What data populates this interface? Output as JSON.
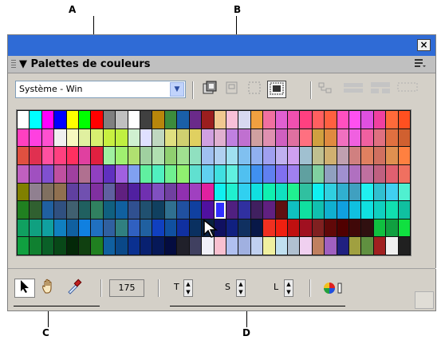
{
  "callouts": {
    "a": "A",
    "b": "B",
    "c": "C",
    "d": "D"
  },
  "panel": {
    "close_label": "×",
    "title": "▼ Palettes de couleurs",
    "options_icon": "menu-lines-icon",
    "palette_select": {
      "value": "Système - Win"
    }
  },
  "toolbar": {
    "count": "175",
    "spin_labels": {
      "t": "T",
      "s": "S",
      "l": "L"
    }
  },
  "palette": {
    "selected_row": 5,
    "selected_col": 16,
    "rows": [
      [
        "#ffffff",
        "#00ffff",
        "#ff00ff",
        "#0000ff",
        "#ffff00",
        "#00ff00",
        "#ff0000",
        "#808080",
        "#c0c0c0",
        "#ffffff",
        "#404040",
        "#b8860b",
        "#3c8c3c",
        "#1a5fa8",
        "#6a2a8a",
        "#9b1e1e",
        "#f0c890",
        "#f8c0d8",
        "#d8d8f0",
        "#f0a040",
        "#f070a0",
        "#e060d0",
        "#f050b0",
        "#ff4080",
        "#ff6060",
        "#ff6040",
        "#ff50c0",
        "#ff50f0",
        "#e050e0",
        "#f040a0",
        "#ff6a3a",
        "#ff5020"
      ],
      [
        "#ff40c0",
        "#ff40e0",
        "#ff50d0",
        "#f0f0f0",
        "#f8f8c0",
        "#e0f0a0",
        "#d8f070",
        "#c8f040",
        "#c0f040",
        "#d0f0d0",
        "#e0e0ff",
        "#c0d8c0",
        "#e0e080",
        "#d0d070",
        "#e0d060",
        "#d0a0e0",
        "#e0b0d0",
        "#c080e0",
        "#c070d0",
        "#d0a0a0",
        "#e090b0",
        "#d060c0",
        "#e070a0",
        "#ff7080",
        "#d0a040",
        "#e08a40",
        "#f070c0",
        "#f060e0",
        "#f060a0",
        "#e07080",
        "#e07040",
        "#d06030"
      ],
      [
        "#e05040",
        "#e03050",
        "#ff50a0",
        "#ff4080",
        "#ff3060",
        "#e040a0",
        "#e02040",
        "#a0f0a0",
        "#a0f070",
        "#b0e070",
        "#a0d0a0",
        "#b0e0b0",
        "#90d070",
        "#a0e090",
        "#90e0c0",
        "#a0c0f0",
        "#b0d0f0",
        "#a0e0f0",
        "#80c0f0",
        "#90b0f0",
        "#a0a0f0",
        "#c0b0f0",
        "#d0a0f0",
        "#a0c0d0",
        "#c0c090",
        "#d0b070",
        "#c0a0b0",
        "#d08080",
        "#e08060",
        "#d07060",
        "#e09050",
        "#ff8040"
      ],
      [
        "#c060c0",
        "#a050c0",
        "#8050d0",
        "#c050a0",
        "#a040a0",
        "#b07090",
        "#9040c0",
        "#6030c0",
        "#a060e0",
        "#80a0f0",
        "#60f0a0",
        "#50f0c0",
        "#70f090",
        "#90f070",
        "#60e0d0",
        "#60d0f0",
        "#40e0e0",
        "#60f0e0",
        "#50c0f0",
        "#4090f0",
        "#6080f0",
        "#8070f0",
        "#a080f0",
        "#60a0a0",
        "#80d0a0",
        "#90a0c0",
        "#a090d0",
        "#b070c0",
        "#c070a0",
        "#c06080",
        "#e06070",
        "#f07060"
      ],
      [
        "#808000",
        "#908090",
        "#807060",
        "#907050",
        "#6040a0",
        "#7050b0",
        "#8030a0",
        "#6060a0",
        "#602080",
        "#5020a0",
        "#7030b0",
        "#8050c0",
        "#7040a0",
        "#9030b0",
        "#a040c0",
        "#e020a0",
        "#10f0f0",
        "#20f0d0",
        "#30d0f0",
        "#10e0e0",
        "#10f0b0",
        "#10e0c0",
        "#20f090",
        "#30c0a0",
        "#10f0f0",
        "#30d0e0",
        "#30b0d0",
        "#40a0c0",
        "#20f0f0",
        "#30c0d0",
        "#40d0f0",
        "#50f0d0"
      ],
      [
        "#208020",
        "#306030",
        "#2060a0",
        "#305080",
        "#406070",
        "#206060",
        "#308060",
        "#106080",
        "#1060a0",
        "#305090",
        "#205070",
        "#104060",
        "#307090",
        "#2050a0",
        "#1040a0",
        "#5010a0",
        "#3030ff",
        "#502080",
        "#3030a0",
        "#402060",
        "#602080",
        "#601010",
        "#10c0c0",
        "#10e0a0",
        "#10c0b0",
        "#10b0d0",
        "#10a0e0",
        "#10c0e0",
        "#10e0e0",
        "#10d0c0",
        "#10e0b0",
        "#10c0a0"
      ],
      [
        "#10a060",
        "#10a080",
        "#10a0a0",
        "#1080c0",
        "#1060a0",
        "#1080e0",
        "#2070c0",
        "#3060a0",
        "#308080",
        "#3060c0",
        "#2060a0",
        "#1040c0",
        "#1050a0",
        "#1030a0",
        "#0a3060",
        "#082040",
        "#101060",
        "#102080",
        "#103060",
        "#081848",
        "#f03020",
        "#f02010",
        "#c01010",
        "#a01020",
        "#802020",
        "#600808",
        "#500000",
        "#400808",
        "#301010",
        "#10c040",
        "#10a040",
        "#10e040"
      ],
      [
        "#10a040",
        "#108030",
        "#0a6028",
        "#084818",
        "#042808",
        "#104010",
        "#208020",
        "#1060a0",
        "#0a4888",
        "#0a3090",
        "#082070",
        "#061858",
        "#040c40",
        "#20202a",
        "#404060",
        "#f0f0f8",
        "#f8c0d0",
        "#b0c0f0",
        "#a0b0e0",
        "#c0d0f0",
        "#f0f0a0",
        "#c0e0f0",
        "#b0c0d0",
        "#f0d0f0",
        "#c08060",
        "#a060c0",
        "#202080",
        "#a0a040",
        "#609040",
        "#a02020",
        "#f0f0f0",
        "#202020"
      ]
    ]
  }
}
